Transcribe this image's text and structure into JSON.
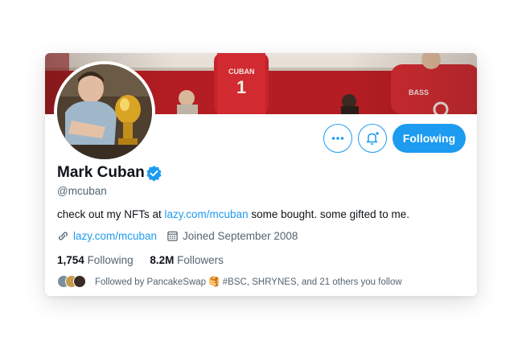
{
  "profile": {
    "name": "Mark Cuban",
    "handle": "@mcuban",
    "bio_prefix": "check out my NFTs at ",
    "bio_link": "lazy.com/mcuban",
    "bio_suffix": " some bought. some gifted to me.",
    "website": "lazy.com/mcuban",
    "joined": "Joined September 2008",
    "following_count": "1,754",
    "following_label": "Following",
    "followers_count": "8.2M",
    "followers_label": "Followers",
    "followed_by": "Followed by PancakeSwap 🥞 #BSC, SHRYNES, and 21 others you follow"
  },
  "actions": {
    "more_icon": "more-horizontal-icon",
    "notify_icon": "bell-plus-icon",
    "follow_label": "Following"
  },
  "colors": {
    "accent": "#1d9bf0",
    "text_primary": "#0f1419",
    "text_secondary": "#536471"
  }
}
